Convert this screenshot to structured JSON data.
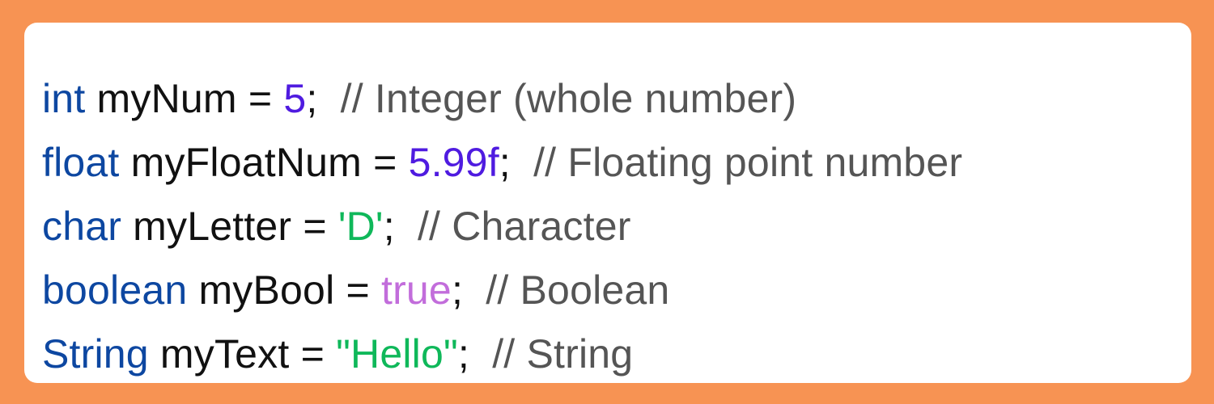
{
  "colors": {
    "background": "#F79353",
    "card": "#FFFFFF",
    "keyword": "#0D47A1",
    "identifier": "#111111",
    "number": "#4F1BE0",
    "string": "#0FB85A",
    "boolean": "#C26DDB",
    "comment": "#555555"
  },
  "code": {
    "lines": [
      {
        "type": "int",
        "name": "myNum",
        "eq": "=",
        "value": "5",
        "semi": ";",
        "comment": "// Integer (whole number)"
      },
      {
        "type": "float",
        "name": "myFloatNum",
        "eq": "=",
        "value": "5.99f",
        "semi": ";",
        "comment": "// Floating point number"
      },
      {
        "type": "char",
        "name": "myLetter",
        "eq": "=",
        "value": "'D'",
        "semi": ";",
        "comment": "// Character"
      },
      {
        "type": "boolean",
        "name": "myBool",
        "eq": "=",
        "value": "true",
        "semi": ";",
        "comment": "// Boolean"
      },
      {
        "type": "String",
        "name": "myText",
        "eq": "=",
        "value": "\"Hello\"",
        "semi": ";",
        "comment": "// String"
      }
    ]
  }
}
